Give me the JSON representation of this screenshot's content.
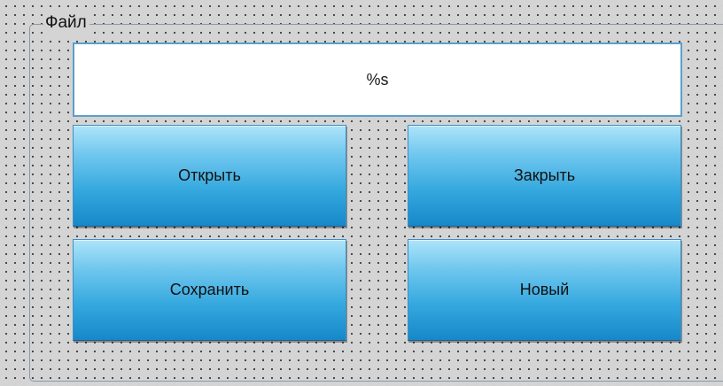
{
  "group": {
    "title": "Файл"
  },
  "display": {
    "value": "%s"
  },
  "buttons": {
    "open": "Открыть",
    "close": "Закрыть",
    "save": "Сохранить",
    "new": "Новый"
  },
  "colors": {
    "button_gradient_top": "#aee4f9",
    "button_gradient_bottom": "#1688c9",
    "field_border": "#5b9fce",
    "background": "#d4d4d4"
  }
}
